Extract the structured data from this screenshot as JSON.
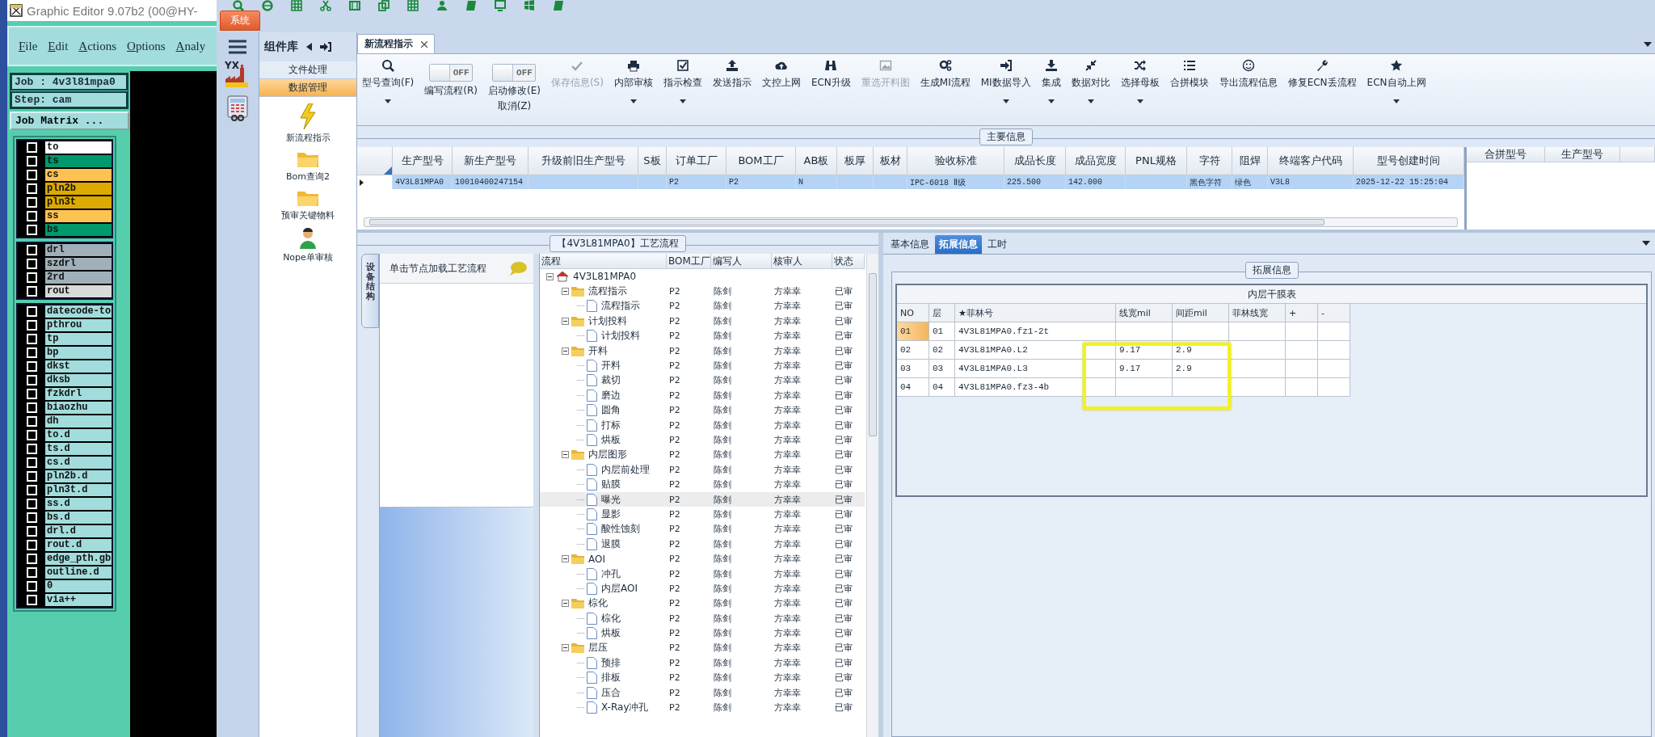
{
  "graphic_editor": {
    "title": "Graphic Editor 9.07b2 (00@HY-",
    "menu": [
      "File",
      "Edit",
      "Actions",
      "Options",
      "Analy"
    ],
    "job": "Job : 4v3l81mpa0",
    "step": "Step: cam",
    "matrix_button": "Job Matrix ...",
    "layer_groups": [
      [
        {
          "name": "to",
          "color": "#ffffff",
          "checked": false
        },
        {
          "name": "ts",
          "color": "#00996e",
          "checked": false
        },
        {
          "name": "cs",
          "color": "#fdc352",
          "checked": false
        },
        {
          "name": "pln2b",
          "color": "#dcaa00",
          "checked": false
        },
        {
          "name": "pln3t",
          "color": "#dcaa00",
          "checked": false
        },
        {
          "name": "ss",
          "color": "#fdc352",
          "checked": false
        },
        {
          "name": "bs",
          "color": "#00996e",
          "checked": false
        }
      ],
      [
        {
          "name": "drl",
          "color": "#9fb0b8",
          "checked": false
        },
        {
          "name": "szdrl",
          "color": "#9fb0b8",
          "checked": false
        },
        {
          "name": "2rd",
          "color": "#9fb0b8",
          "checked": false
        },
        {
          "name": "rout",
          "color": "#dadada",
          "checked": false
        }
      ],
      [
        {
          "name": "datecode-to",
          "color": "#a2dcdc",
          "checked": false
        },
        {
          "name": "pthrou",
          "color": "#a2dcdc",
          "checked": false
        },
        {
          "name": "tp",
          "color": "#a2dcdc",
          "checked": false
        },
        {
          "name": "bp",
          "color": "#a2dcdc",
          "checked": false
        },
        {
          "name": "dkst",
          "color": "#a2dcdc",
          "checked": false
        },
        {
          "name": "dksb",
          "color": "#a2dcdc",
          "checked": false
        },
        {
          "name": "fzkdrl",
          "color": "#a2dcdc",
          "checked": false
        },
        {
          "name": "biaozhu",
          "color": "#a2dcdc",
          "checked": false
        },
        {
          "name": "dh",
          "color": "#a2dcdc",
          "checked": false
        },
        {
          "name": "to.d",
          "color": "#a2dcdc",
          "checked": false
        },
        {
          "name": "ts.d",
          "color": "#a2dcdc",
          "checked": false
        },
        {
          "name": "cs.d",
          "color": "#a2dcdc",
          "checked": false
        },
        {
          "name": "pln2b.d",
          "color": "#a2dcdc",
          "checked": false
        },
        {
          "name": "pln3t.d",
          "color": "#a2dcdc",
          "checked": false
        },
        {
          "name": "ss.d",
          "color": "#a2dcdc",
          "checked": false
        },
        {
          "name": "bs.d",
          "color": "#a2dcdc",
          "checked": false
        },
        {
          "name": "drl.d",
          "color": "#a2dcdc",
          "checked": false
        },
        {
          "name": "rout.d",
          "color": "#a2dcdc",
          "checked": false
        },
        {
          "name": "edge_pth.gb",
          "color": "#a2dcdc",
          "checked": false
        },
        {
          "name": "outline.d",
          "color": "#a2dcdc",
          "checked": false
        },
        {
          "name": "0",
          "color": "#a2dcdc",
          "checked": false
        },
        {
          "name": "via++",
          "color": "#a2dcdc",
          "checked": false
        }
      ]
    ]
  },
  "app": {
    "system_tab": "系统",
    "quick_icons": [
      {
        "kind": "search"
      },
      {
        "kind": "globe"
      },
      {
        "kind": "grid"
      },
      {
        "kind": "scissors"
      },
      {
        "kind": "film"
      },
      {
        "kind": "copy"
      },
      {
        "kind": "grid"
      },
      {
        "kind": "person"
      },
      {
        "kind": "book"
      },
      {
        "kind": "monitor"
      },
      {
        "kind": "windows"
      },
      {
        "kind": "book"
      }
    ],
    "side_icons": [
      {
        "kind": "menu"
      },
      {
        "kind": "factory",
        "label": "YX"
      },
      {
        "kind": "calculator"
      }
    ]
  },
  "sidebar": {
    "title": "组件库",
    "items": [
      {
        "label": "文件处理",
        "selected": false
      },
      {
        "label": "数据管理",
        "selected": true
      }
    ],
    "components": [
      {
        "label": "新流程指示",
        "kind": "lightning"
      },
      {
        "label": "Bom查询2",
        "kind": "folder"
      },
      {
        "label": "预审关键物料",
        "kind": "folder"
      },
      {
        "label": "Nope单审核",
        "kind": "person"
      }
    ]
  },
  "document_tabs": [
    {
      "label": "新流程指示",
      "selected": true
    }
  ],
  "ribbon": [
    {
      "kind": "search",
      "label": "型号查询(F)",
      "dropdown": true,
      "disabled": false
    },
    {
      "kind": "toggle",
      "label": "编写流程(R)",
      "toggle_text": "OFF",
      "on": false
    },
    {
      "kind": "toggle",
      "label": "启动修改(E)",
      "sub_label": "取消(Z)",
      "toggle_text": "OFF",
      "on": false
    },
    {
      "kind": "check",
      "label": "保存信息(S)",
      "dropdown": false,
      "disabled": true
    },
    {
      "kind": "print",
      "label": "内部审核",
      "dropdown": true,
      "disabled": false
    },
    {
      "kind": "checkbox",
      "label": "指示检查",
      "dropdown": true,
      "disabled": false
    },
    {
      "kind": "upload",
      "label": "发送指示",
      "dropdown": false,
      "disabled": false
    },
    {
      "kind": "cloud",
      "label": "文控上网",
      "dropdown": false,
      "disabled": false
    },
    {
      "kind": "binoculars",
      "label": "ECN升级",
      "dropdown": false,
      "disabled": false
    },
    {
      "kind": "image",
      "label": "重选开料图",
      "dropdown": false,
      "disabled": true
    },
    {
      "kind": "gears",
      "label": "生成MI流程",
      "dropdown": false,
      "disabled": false
    },
    {
      "kind": "signin",
      "label": "MI数据导入",
      "dropdown": true,
      "disabled": false
    },
    {
      "kind": "download",
      "label": "集成",
      "dropdown": true,
      "disabled": false
    },
    {
      "kind": "compress",
      "label": "数据对比",
      "dropdown": true,
      "disabled": false
    },
    {
      "kind": "shuffle",
      "label": "选择母板",
      "dropdown": true,
      "disabled": false
    },
    {
      "kind": "list",
      "label": "合拼模块",
      "dropdown": false,
      "disabled": false
    },
    {
      "kind": "smile",
      "label": "导出流程信息",
      "dropdown": false,
      "disabled": false
    },
    {
      "kind": "wrench",
      "label": "修复ECN丢流程",
      "dropdown": false,
      "disabled": false
    },
    {
      "kind": "star",
      "label": "ECN自动上网",
      "dropdown": true,
      "disabled": false
    }
  ],
  "main_info": {
    "title": "主要信息",
    "columns": [
      "生产型号",
      "新生产型号",
      "升级前旧生产型号",
      "S板",
      "订单工厂",
      "BOM工厂",
      "AB板",
      "板厚",
      "板材",
      "验收标准",
      "成品长度",
      "成品宽度",
      "PNL规格",
      "字符",
      "阻焊",
      "终端客户代码",
      "型号创建时间"
    ],
    "rows": [
      {
        "selected": true,
        "cells": [
          "4V3L81MPA0",
          "10010400247154",
          "",
          "",
          "P2",
          "P2",
          "N",
          "",
          "",
          "IPC-6018 Ⅱ级",
          "225.500",
          "142.000",
          "",
          "黑色字符",
          "绿色",
          "V3L8",
          "2025-12-22 15:25:04"
        ]
      }
    ],
    "merge_table": {
      "columns": [
        "合拼型号",
        "生产型号"
      ]
    }
  },
  "process_panel": {
    "title": "【4V3L81MPA0】工艺流程",
    "side_tab": "设备结构",
    "hint": "单击节点加载工艺流程",
    "tree": {
      "columns": [
        "流程",
        "BOM工厂",
        "编写人",
        "核审人",
        "状态"
      ],
      "root": {
        "kind": "root",
        "label": "4V3L81MPA0",
        "expanded": true,
        "selected": false,
        "children": [
          {
            "kind": "group",
            "label": "流程指示",
            "bom": "P2",
            "writer": "陈剑",
            "reviewer": "方幸幸",
            "status": "已审",
            "expanded": true,
            "selected": false,
            "children": [
              {
                "kind": "step",
                "label": "流程指示",
                "bom": "P2",
                "writer": "陈剑",
                "reviewer": "方幸幸",
                "status": "已审",
                "selected": false
              }
            ]
          },
          {
            "kind": "group",
            "label": "计划投料",
            "bom": "P2",
            "writer": "陈剑",
            "reviewer": "方幸幸",
            "status": "已审",
            "expanded": true,
            "selected": false,
            "children": [
              {
                "kind": "step",
                "label": "计划投料",
                "bom": "P2",
                "writer": "陈剑",
                "reviewer": "方幸幸",
                "status": "已审",
                "selected": false
              }
            ]
          },
          {
            "kind": "group",
            "label": "开料",
            "bom": "P2",
            "writer": "陈剑",
            "reviewer": "方幸幸",
            "status": "已审",
            "expanded": true,
            "selected": false,
            "children": [
              {
                "kind": "step",
                "label": "开料",
                "bom": "P2",
                "writer": "陈剑",
                "reviewer": "方幸幸",
                "status": "已审",
                "selected": false
              },
              {
                "kind": "step",
                "label": "裁切",
                "bom": "P2",
                "writer": "陈剑",
                "reviewer": "方幸幸",
                "status": "已审",
                "selected": false
              },
              {
                "kind": "step",
                "label": "磨边",
                "bom": "P2",
                "writer": "陈剑",
                "reviewer": "方幸幸",
                "status": "已审",
                "selected": false
              },
              {
                "kind": "step",
                "label": "圆角",
                "bom": "P2",
                "writer": "陈剑",
                "reviewer": "方幸幸",
                "status": "已审",
                "selected": false
              },
              {
                "kind": "step",
                "label": "打标",
                "bom": "P2",
                "writer": "陈剑",
                "reviewer": "方幸幸",
                "status": "已审",
                "selected": false
              },
              {
                "kind": "step",
                "label": "烘板",
                "bom": "P2",
                "writer": "陈剑",
                "reviewer": "方幸幸",
                "status": "已审",
                "selected": false
              }
            ]
          },
          {
            "kind": "group",
            "label": "内层图形",
            "bom": "P2",
            "writer": "陈剑",
            "reviewer": "方幸幸",
            "status": "已审",
            "expanded": true,
            "selected": false,
            "children": [
              {
                "kind": "step",
                "label": "内层前处理",
                "bom": "P2",
                "writer": "陈剑",
                "reviewer": "方幸幸",
                "status": "已审",
                "selected": false
              },
              {
                "kind": "step",
                "label": "贴膜",
                "bom": "P2",
                "writer": "陈剑",
                "reviewer": "方幸幸",
                "status": "已审",
                "selected": false
              },
              {
                "kind": "step",
                "label": "曝光",
                "bom": "P2",
                "writer": "陈剑",
                "reviewer": "方幸幸",
                "status": "已审",
                "selected": true
              },
              {
                "kind": "step",
                "label": "显影",
                "bom": "P2",
                "writer": "陈剑",
                "reviewer": "方幸幸",
                "status": "已审",
                "selected": false
              },
              {
                "kind": "step",
                "label": "酸性蚀刻",
                "bom": "P2",
                "writer": "陈剑",
                "reviewer": "方幸幸",
                "status": "已审",
                "selected": false
              },
              {
                "kind": "step",
                "label": "退膜",
                "bom": "P2",
                "writer": "陈剑",
                "reviewer": "方幸幸",
                "status": "已审",
                "selected": false
              }
            ]
          },
          {
            "kind": "group",
            "label": "AOI",
            "bom": "P2",
            "writer": "陈剑",
            "reviewer": "方幸幸",
            "status": "已审",
            "expanded": true,
            "selected": false,
            "children": [
              {
                "kind": "step",
                "label": "冲孔",
                "bom": "P2",
                "writer": "陈剑",
                "reviewer": "方幸幸",
                "status": "已审",
                "selected": false
              },
              {
                "kind": "step",
                "label": "内层AOI",
                "bom": "P2",
                "writer": "陈剑",
                "reviewer": "方幸幸",
                "status": "已审",
                "selected": false
              }
            ]
          },
          {
            "kind": "group",
            "label": "棕化",
            "bom": "P2",
            "writer": "陈剑",
            "reviewer": "方幸幸",
            "status": "已审",
            "expanded": true,
            "selected": false,
            "children": [
              {
                "kind": "step",
                "label": "棕化",
                "bom": "P2",
                "writer": "陈剑",
                "reviewer": "方幸幸",
                "status": "已审",
                "selected": false
              },
              {
                "kind": "step",
                "label": "烘板",
                "bom": "P2",
                "writer": "陈剑",
                "reviewer": "方幸幸",
                "status": "已审",
                "selected": false
              }
            ]
          },
          {
            "kind": "group",
            "label": "层压",
            "bom": "P2",
            "writer": "陈剑",
            "reviewer": "方幸幸",
            "status": "已审",
            "expanded": true,
            "selected": false,
            "children": [
              {
                "kind": "step",
                "label": "预排",
                "bom": "P2",
                "writer": "陈剑",
                "reviewer": "方幸幸",
                "status": "已审",
                "selected": false
              },
              {
                "kind": "step",
                "label": "排板",
                "bom": "P2",
                "writer": "陈剑",
                "reviewer": "方幸幸",
                "status": "已审",
                "selected": false
              },
              {
                "kind": "step",
                "label": "压合",
                "bom": "P2",
                "writer": "陈剑",
                "reviewer": "方幸幸",
                "status": "已审",
                "selected": false
              },
              {
                "kind": "step",
                "label": "X-Ray冲孔",
                "bom": "P2",
                "writer": "陈剑",
                "reviewer": "方幸幸",
                "status": "已审",
                "selected": false
              }
            ]
          }
        ]
      }
    }
  },
  "detail_panel": {
    "tabs": [
      {
        "label": "基本信息",
        "selected": false
      },
      {
        "label": "拓展信息",
        "selected": true
      },
      {
        "label": "工时",
        "selected": false
      }
    ],
    "group_title": "拓展信息",
    "table": {
      "title": "内层干膜表",
      "columns": [
        "NO",
        "层",
        "★菲林号",
        "线宽mil",
        "间距mil",
        "菲林线宽",
        "+",
        "-"
      ],
      "rows": [
        {
          "selected": true,
          "cells": [
            "01",
            "01",
            "4V3L81MPA0.fz1-2t",
            "",
            "",
            "",
            "",
            ""
          ]
        },
        {
          "selected": false,
          "cells": [
            "02",
            "02",
            "4V3L81MPA0.L2",
            "9.17",
            "2.9",
            "",
            "",
            ""
          ]
        },
        {
          "selected": false,
          "cells": [
            "03",
            "03",
            "4V3L81MPA0.L3",
            "9.17",
            "2.9",
            "",
            "",
            ""
          ]
        },
        {
          "selected": false,
          "cells": [
            "04",
            "04",
            "4V3L81MPA0.fz3-4b",
            "",
            "",
            "",
            "",
            ""
          ]
        }
      ]
    }
  }
}
